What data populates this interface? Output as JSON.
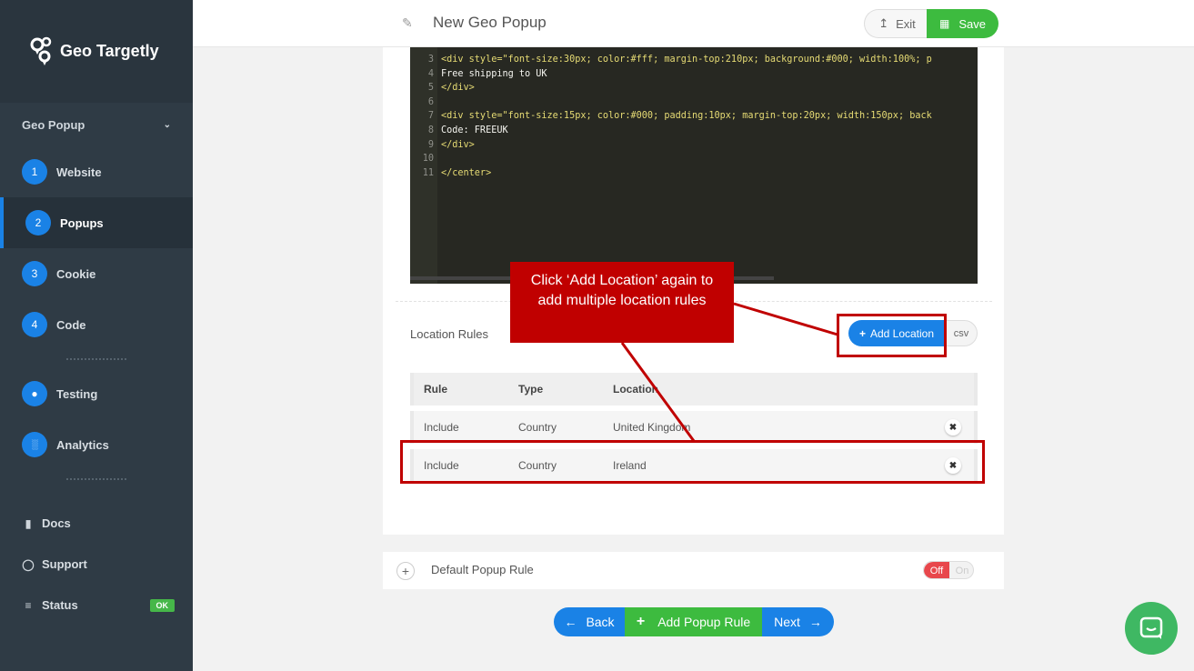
{
  "brand": {
    "name": "Geo Targetly"
  },
  "sidebar": {
    "section": "Geo Popup",
    "steps": [
      {
        "num": "1",
        "label": "Website"
      },
      {
        "num": "2",
        "label": "Popups"
      },
      {
        "num": "3",
        "label": "Cookie"
      },
      {
        "num": "4",
        "label": "Code"
      }
    ],
    "tools": [
      {
        "label": "Testing",
        "icon": "globe-icon"
      },
      {
        "label": "Analytics",
        "icon": "bar-chart-icon"
      }
    ],
    "links": [
      {
        "label": "Docs",
        "icon": "book-icon"
      },
      {
        "label": "Support",
        "icon": "chat-icon"
      },
      {
        "label": "Status",
        "icon": "database-icon",
        "badge": "OK"
      }
    ]
  },
  "header": {
    "title": "New Geo Popup",
    "exit_label": "Exit",
    "save_label": "Save"
  },
  "editor": {
    "lines": [
      {
        "n": "3",
        "text": "<div style=\"font-size:30px; color:#fff; margin-top:210px; background:#000; width:100%; p"
      },
      {
        "n": "4",
        "text": "Free shipping to UK"
      },
      {
        "n": "5",
        "text": "</div>"
      },
      {
        "n": "6",
        "text": ""
      },
      {
        "n": "7",
        "text": "<div style=\"font-size:15px; color:#000; padding:10px; margin-top:20px; width:150px; back"
      },
      {
        "n": "8",
        "text": "Code: FREEUK"
      },
      {
        "n": "9",
        "text": "</div>"
      },
      {
        "n": "10",
        "text": ""
      },
      {
        "n": "11",
        "text": "</center>"
      }
    ]
  },
  "location_rules": {
    "label": "Location Rules",
    "add_label": "Add Location",
    "csv_label": "csv",
    "columns": [
      "Rule",
      "Type",
      "Location"
    ],
    "rows": [
      {
        "rule": "Include",
        "type": "Country",
        "location": "United Kingdom"
      },
      {
        "rule": "Include",
        "type": "Country",
        "location": "Ireland"
      }
    ]
  },
  "default_rule": {
    "label": "Default Popup Rule",
    "off": "Off",
    "on": "On"
  },
  "footer_nav": {
    "back": "Back",
    "add_rule": "Add Popup Rule",
    "next": "Next"
  },
  "annotation": {
    "callout_line1": "Click ‘Add Location’ again to",
    "callout_line2": "add multiple location rules"
  },
  "colors": {
    "accent_blue": "#1a82e6",
    "accent_green": "#3dbb3f",
    "annotation_red": "#c00000",
    "sidebar_bg": "#2f3b45"
  }
}
